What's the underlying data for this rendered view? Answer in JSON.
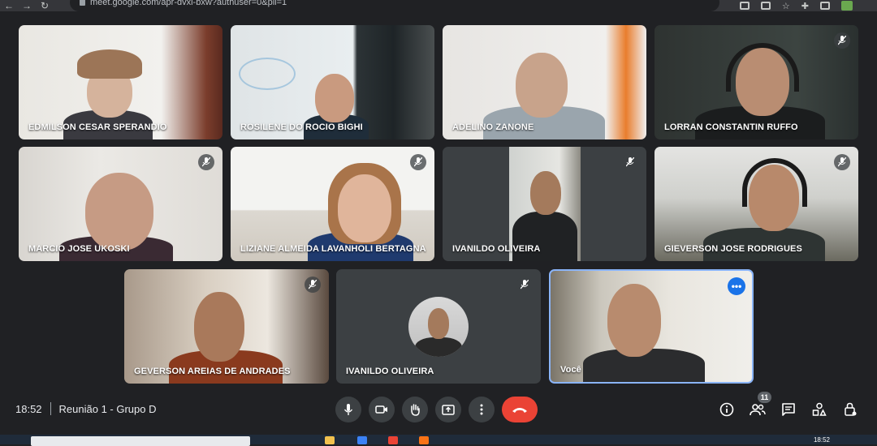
{
  "browser": {
    "url": "meet.google.com/apr-dvxi-bxw?authuser=0&pli=1"
  },
  "participants": [
    {
      "name": "EDMILSON CESAR SPERANDIO"
    },
    {
      "name": "ROSILENE DO ROCIO BIGHI"
    },
    {
      "name": "ADELINO ZANONE"
    },
    {
      "name": "LORRAN CONSTANTIN RUFFO"
    },
    {
      "name": "MARCIO JOSE UKOSKI"
    },
    {
      "name": "LIZIANE ALMEIDA LAVANHOLI BERTAGNA"
    },
    {
      "name": "IVANILDO OLIVEIRA"
    },
    {
      "name": "GIEVERSON JOSE RODRIGUES"
    },
    {
      "name": "GEVERSON AREIAS DE ANDRADES"
    },
    {
      "name": "IVANILDO OLIVEIRA"
    },
    {
      "name": "Você"
    }
  ],
  "meeting": {
    "time": "18:52",
    "title": "Reunião 1 - Grupo D"
  },
  "people_count": "11",
  "taskbar": {
    "clock": "18:52"
  },
  "colors": {
    "hangup": "#ea4335",
    "accent": "#1a73e8",
    "self_border": "#8ab4f8"
  }
}
